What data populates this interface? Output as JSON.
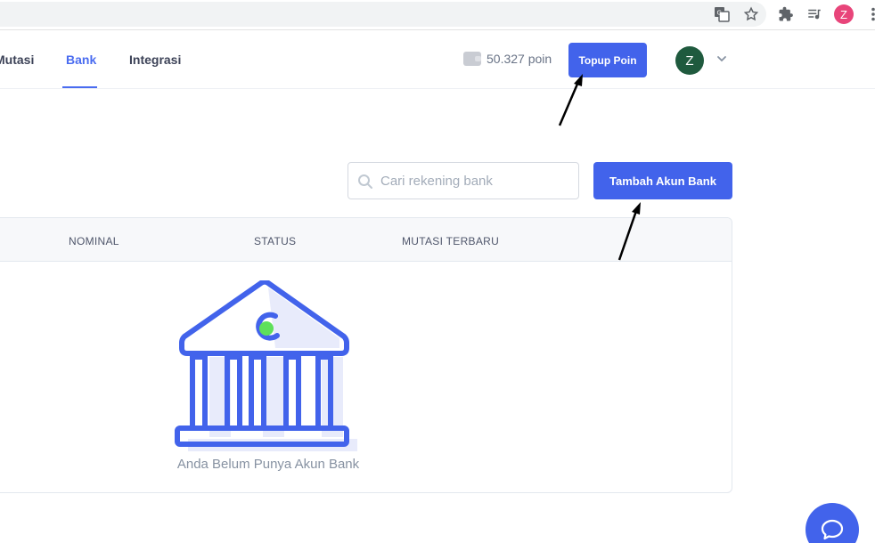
{
  "nav": {
    "tabs": [
      {
        "label": "Mutasi"
      },
      {
        "label": "Bank"
      },
      {
        "label": "Integrasi"
      }
    ]
  },
  "wallet": {
    "balance": "50.327 poin"
  },
  "header": {
    "topup_label": "Topup Poin",
    "avatar_initial": "Z"
  },
  "browser": {
    "profile_initial": "Z"
  },
  "toolbar": {
    "search_placeholder": "Cari rekening bank",
    "add_bank_label": "Tambah Akun Bank"
  },
  "table": {
    "columns": [
      "NOMINAL",
      "STATUS",
      "MUTASI TERBARU"
    ],
    "empty_message": "Anda Belum Punya Akun Bank"
  },
  "colors": {
    "accent": "#4263eb",
    "active_tab": "#4a6cf0",
    "illustration_dot": "#5ee05a"
  }
}
